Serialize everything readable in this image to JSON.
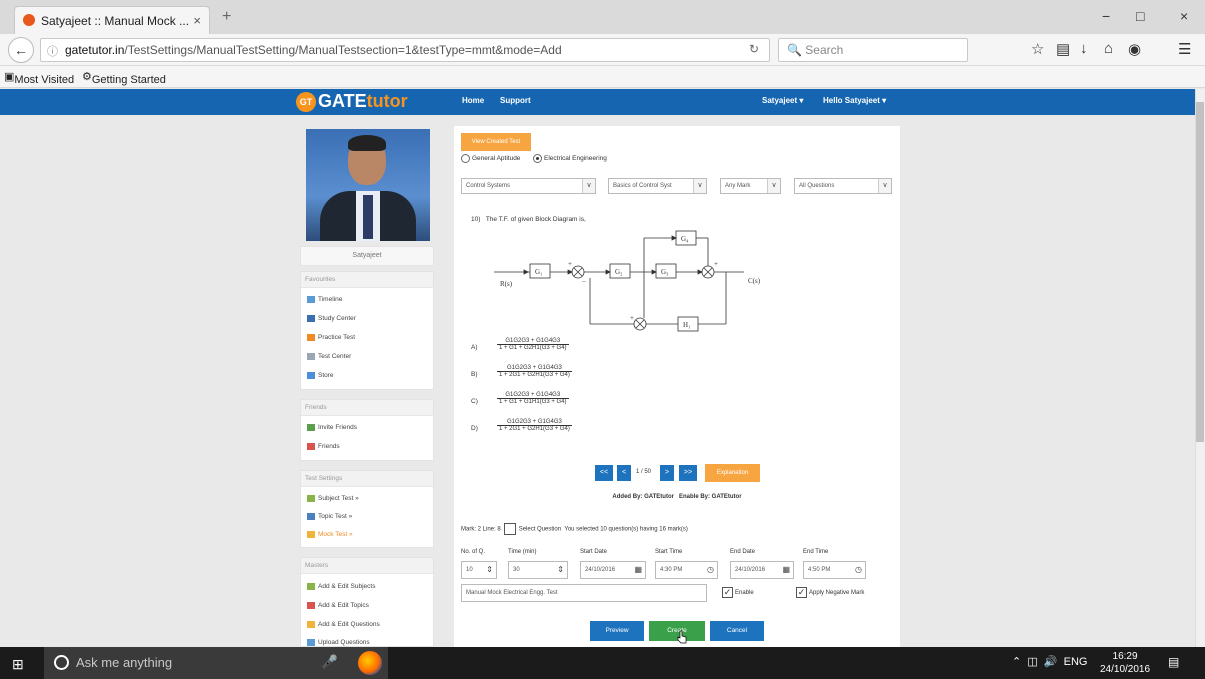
{
  "browser": {
    "tab_title": "Satyajeet :: Manual Mock ...",
    "tab_close": "×",
    "new_tab": "+",
    "window_min": "−",
    "window_max": "□",
    "window_close": "×",
    "url_domain": "gatetutor.in",
    "url_path": "/TestSettings/ManualTestSetting/ManualTestsection=1&testType=mmt&mode=Add",
    "search_placeholder": "Search",
    "bookmarks": [
      "Most Visited",
      "Getting Started"
    ]
  },
  "site": {
    "logo_gt": "GT",
    "logo_gate": "GATE",
    "logo_tutor": "tutor",
    "nav_home": "Home",
    "nav_support": "Support",
    "nav_user": "Satyajeet",
    "nav_hello": "Hello Satyajeet"
  },
  "sidebar": {
    "username": "Satyajeet",
    "sections": [
      {
        "title": "Favourites",
        "items": [
          "Timeline",
          "Study Center",
          "Practice Test",
          "Test Center",
          "Store"
        ]
      },
      {
        "title": "Friends",
        "items": [
          "Invite Friends",
          "Friends"
        ]
      },
      {
        "title": "Test Settings",
        "items": [
          "Subject Test »",
          "Topic Test »",
          "Mock Test »"
        ]
      },
      {
        "title": "Masters",
        "items": [
          "Add & Edit Subjects",
          "Add & Edit Topics",
          "Add & Edit Questions",
          "Upload Questions"
        ]
      }
    ]
  },
  "main": {
    "view_created": "View Created Test",
    "radio_general": "General Aptitude",
    "radio_electrical": "Electrical Engineering",
    "filters": [
      "Control Systems",
      "Basics of Control Syst",
      "Any Mark",
      "All Questions"
    ],
    "question": "The T.F. of given Block Diagram is,",
    "question_no": "10)",
    "options": [
      {
        "label": "A)",
        "num": "G1G2G3 + G1G4G3",
        "den": "1 + G1 + G2H1(G3 + G4)"
      },
      {
        "label": "B)",
        "num": "G1G2G3 + G1G4G3",
        "den": "1 + 2G1 + G2H1(G3 + G4)"
      },
      {
        "label": "C)",
        "num": "G1G2G3 + G1G4G3",
        "den": "1 + G1 + G1H1(G3 + G4)"
      },
      {
        "label": "D)",
        "num": "G1G2G3 + G1G4G3",
        "den": "1 + 2G1 + G2H1(G3 + G4)"
      }
    ],
    "pager": {
      "first": "<<",
      "prev": "<",
      "info": "1 / 50",
      "next": ">",
      "last": ">>",
      "explanation": "Explanation"
    },
    "added_by": "Added By: GATEtutor",
    "enabled_by": "Enable By: GATEtutor",
    "mark_line": "Mark: 2  Line: 8",
    "select_question": "Select Question",
    "selected_info": "You selected 10 question(s) having 16 mark(s)",
    "fields": {
      "noq_label": "No. of Q.",
      "noq_value": "10",
      "time_label": "Time (min)",
      "time_value": "30",
      "start_date_label": "Start Date",
      "start_date_value": "24/10/2016",
      "start_time_label": "Start Time",
      "start_time_value": "4:30 PM",
      "end_date_label": "End Date",
      "end_date_value": "24/10/2016",
      "end_time_label": "End Time",
      "end_time_value": "4:50 PM",
      "test_name": "Manual Mock Electrical Engg. Test",
      "enable": "Enable",
      "negative": "Apply Negative Mark"
    },
    "buttons": {
      "preview": "Preview",
      "create": "Create",
      "cancel": "Cancel"
    }
  },
  "taskbar": {
    "search": "Ask me anything",
    "lang": "ENG",
    "time": "16:29",
    "date": "24/10/2016"
  },
  "colors": {
    "site_blue": "#1565b0",
    "accent_orange": "#f7a541",
    "create_green": "#3aa14a"
  }
}
